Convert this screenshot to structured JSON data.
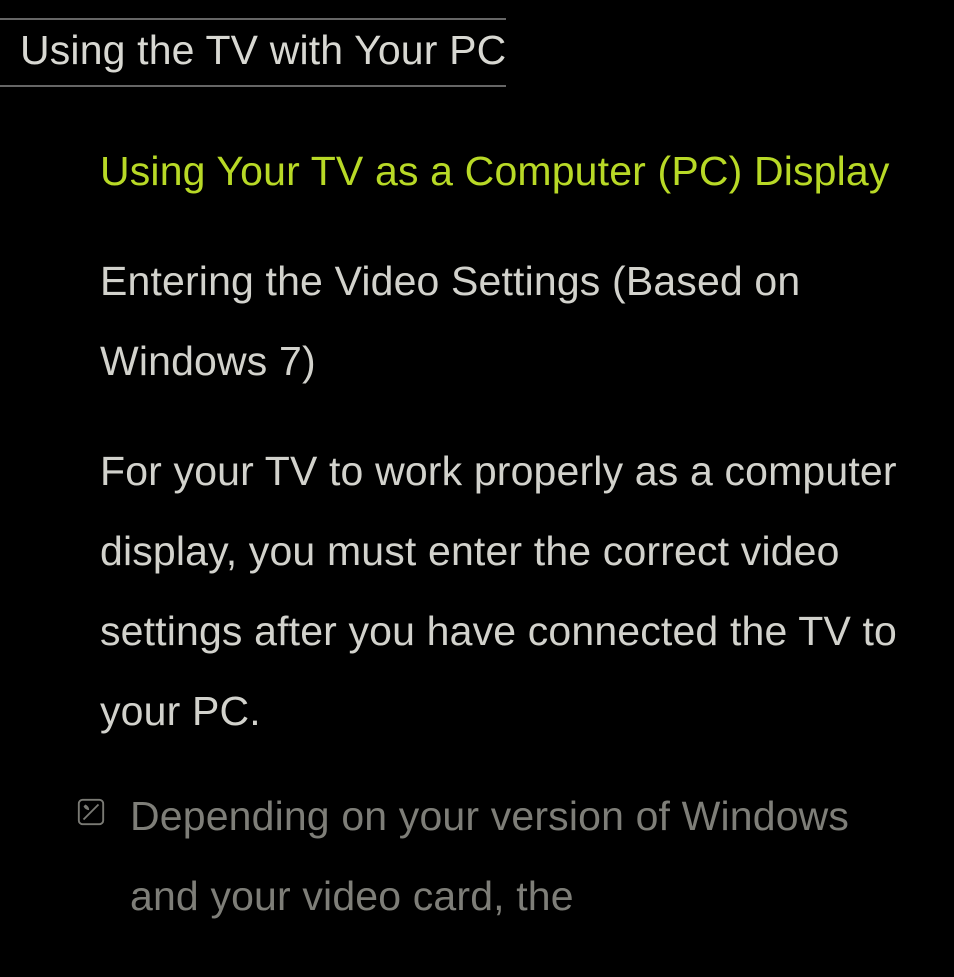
{
  "page": {
    "title": "Using the TV with Your PC"
  },
  "content": {
    "subtitle": "Using Your TV as a Computer (PC) Display",
    "section_heading": "Entering the Video Settings (Based on Windows 7)",
    "body": "For your TV to work properly as a computer display, you must enter the correct video settings after you have connected the TV to your PC.",
    "note": "Depending on your version of Windows and your video card, the"
  }
}
